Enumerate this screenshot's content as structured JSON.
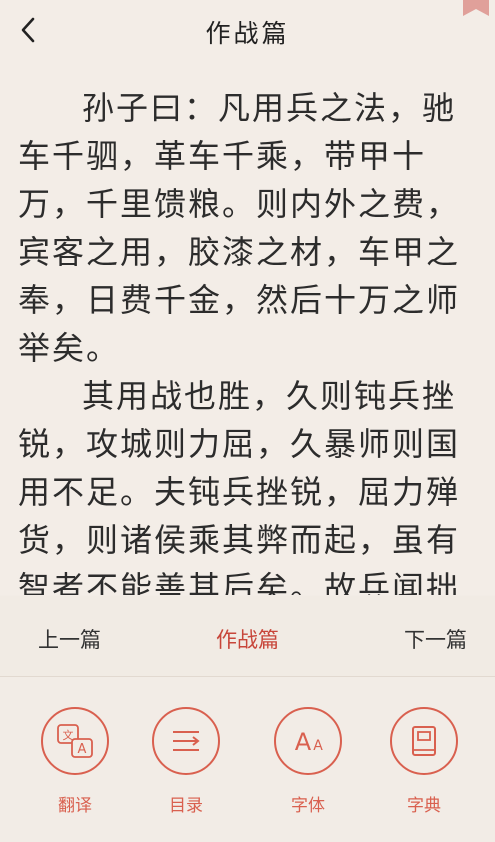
{
  "header": {
    "title": "作战篇",
    "back_icon": "chevron-left-icon",
    "bookmark_color": "#e0a09a"
  },
  "content": {
    "paragraphs": [
      "孙子曰：凡用兵之法，驰车千驷，革车千乘，带甲十万，千里馈粮。则内外之费，宾客之用，胶漆之材，车甲之奉，日费千金，然后十万之师举矣。",
      "其用战也胜，久则钝兵挫锐，攻城则力屈，久暴师则国用不足。夫钝兵挫锐，屈力殚货，则诸侯乘其弊而起，虽有智者不能善其后矣。故兵闻拙"
    ]
  },
  "chapter_nav": {
    "prev_label": "上一篇",
    "current_label": "作战篇",
    "next_label": "下一篇"
  },
  "toolbar": {
    "accent_color": "#d9604f",
    "items": [
      {
        "label": "翻译",
        "icon": "translate-icon"
      },
      {
        "label": "目录",
        "icon": "toc-icon"
      },
      {
        "label": "字体",
        "icon": "font-size-icon"
      },
      {
        "label": "字典",
        "icon": "dictionary-icon"
      }
    ]
  }
}
